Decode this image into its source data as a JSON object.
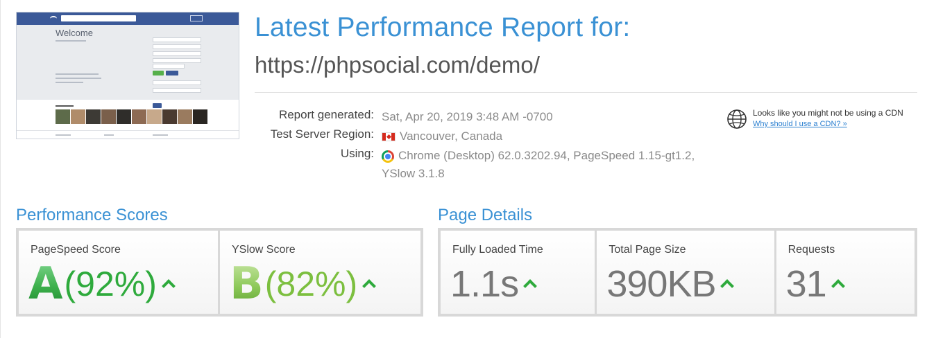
{
  "report": {
    "title": "Latest Performance Report for:",
    "url": "https://phpsocial.com/demo/"
  },
  "thumbnail": {
    "welcome": "Welcome"
  },
  "info": {
    "generated_label": "Report generated:",
    "generated_value": "Sat, Apr 20, 2019 3:48 AM -0700",
    "region_label": "Test Server Region:",
    "region_value": "Vancouver, Canada",
    "using_label": "Using:",
    "using_value": "Chrome (Desktop) 62.0.3202.94, PageSpeed 1.15-gt1.2, YSlow 3.1.8"
  },
  "cdn": {
    "message": "Looks like you might not be using a CDN",
    "link": "Why should I use a CDN? »"
  },
  "performance": {
    "title": "Performance Scores",
    "pagespeed": {
      "label": "PageSpeed Score",
      "grade": "A",
      "percent": "(92%)"
    },
    "yslow": {
      "label": "YSlow Score",
      "grade": "B",
      "percent": "(82%)"
    }
  },
  "details": {
    "title": "Page Details",
    "load_time": {
      "label": "Fully Loaded Time",
      "value": "1.1s"
    },
    "page_size": {
      "label": "Total Page Size",
      "value": "390KB"
    },
    "requests": {
      "label": "Requests",
      "value": "31"
    }
  },
  "colors": {
    "accent": "#3a91d4",
    "grade_a": "#2eaa3c",
    "grade_b": "#7cbf3f",
    "trend_up": "#2eaa3c"
  },
  "icons": {
    "flag": "canada-flag-icon",
    "browser": "chrome-icon",
    "cdn": "globe-icon",
    "trend": "up-arrow-icon"
  }
}
